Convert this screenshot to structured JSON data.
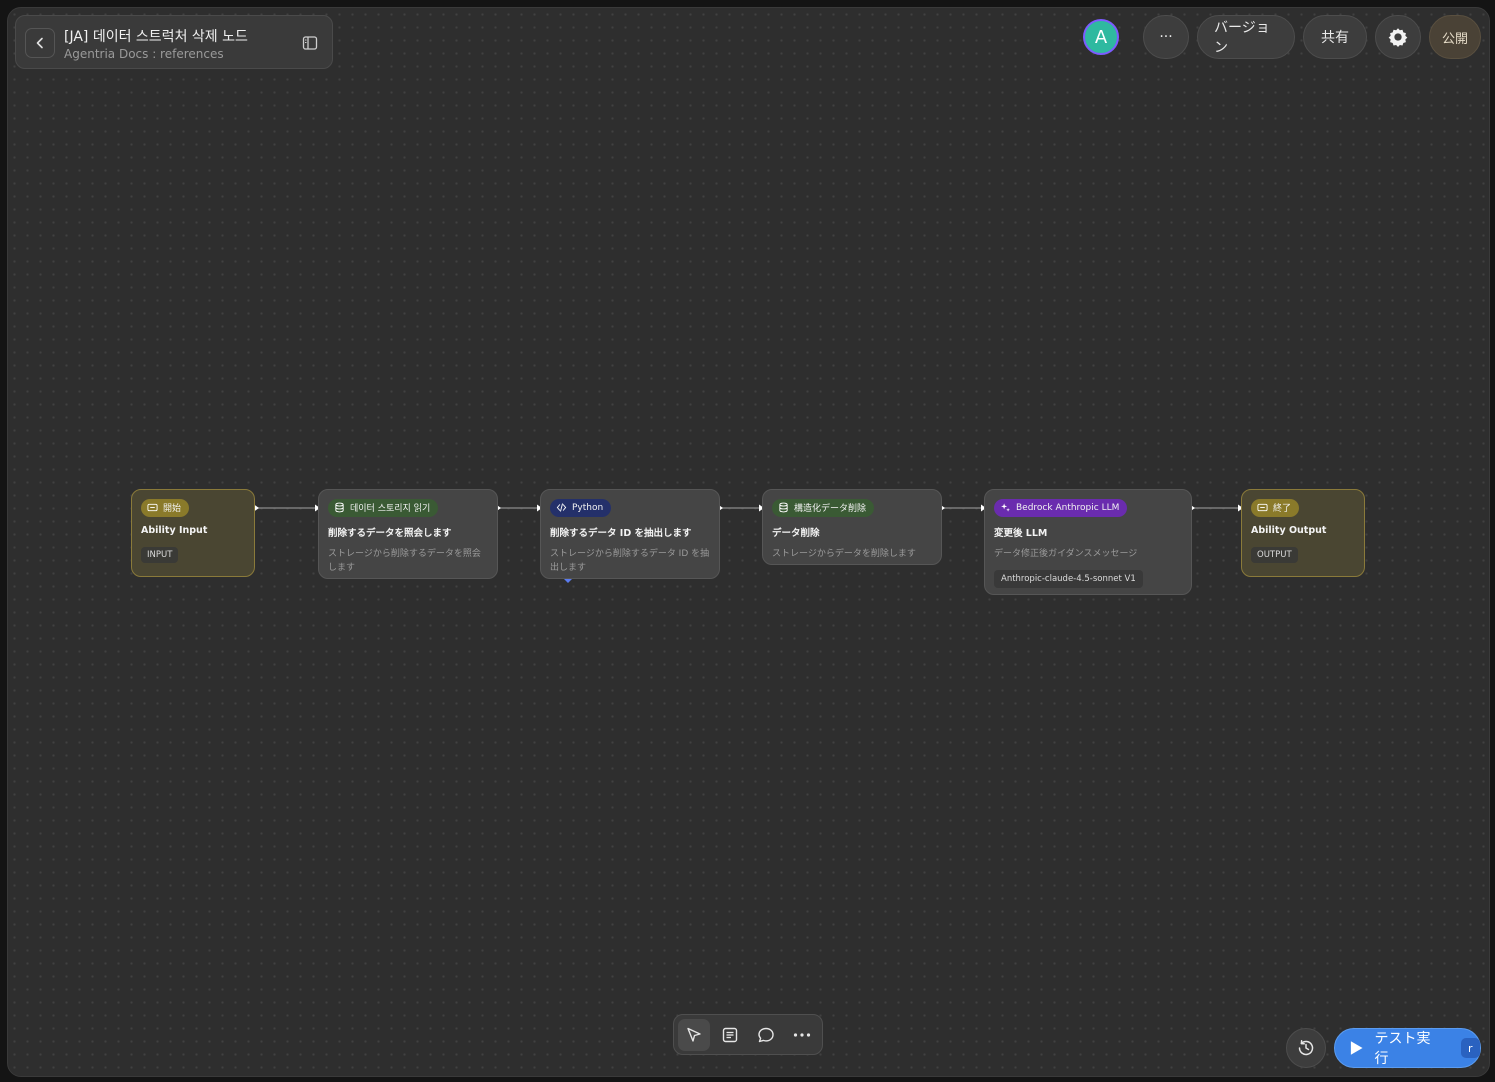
{
  "header": {
    "title": "[JA] 데이터 스트럭처 삭제 노드",
    "subtitle": "Agentria Docs : references"
  },
  "top_actions": {
    "avatar_letter": "A",
    "more_label": "···",
    "version_label": "バージョン",
    "share_label": "共有",
    "publish_label": "公開"
  },
  "nodes": [
    {
      "chip": "開始",
      "title": "Ability Input",
      "tag": "INPUT"
    },
    {
      "chip": "데이터 스토리지 읽기",
      "title": "削除するデータを照会します",
      "desc": "ストレージから削除するデータを照会します"
    },
    {
      "chip": "Python",
      "title": "削除するデータ ID を抽出します",
      "desc": "ストレージから削除するデータ ID を抽出します"
    },
    {
      "chip": "構造化データ削除",
      "title": "データ削除",
      "desc": "ストレージからデータを削除します"
    },
    {
      "chip": "Bedrock Anthropic LLM",
      "title": "変更後 LLM",
      "desc": "データ修正後ガイダンスメッセージ",
      "model": "Anthropic-claude-4.5-sonnet V1"
    },
    {
      "chip": "終了",
      "title": "Ability Output",
      "tag": "OUTPUT"
    }
  ],
  "colors": {
    "start_chip": "#8a7a2a",
    "storage_chip": "#3a5a34",
    "python_chip": "#24306a",
    "llm_chip": "#6a2cae",
    "run_button": "#3b82e6",
    "avatar": "#2fb9a0"
  },
  "icons": {
    "back": "chevron-left-icon",
    "sidebar": "sidebar-toggle-icon",
    "settings": "gear-icon",
    "io": "io-icon",
    "database": "database-icon",
    "code": "code-icon",
    "llm": "sparkle-icon",
    "pointer": "pointer-icon",
    "note": "note-icon",
    "comment": "comment-icon",
    "more": "more-icon",
    "history": "history-icon",
    "play": "play-icon"
  },
  "bottom": {
    "run_label": "テスト実行",
    "run_shortcut": "r"
  }
}
